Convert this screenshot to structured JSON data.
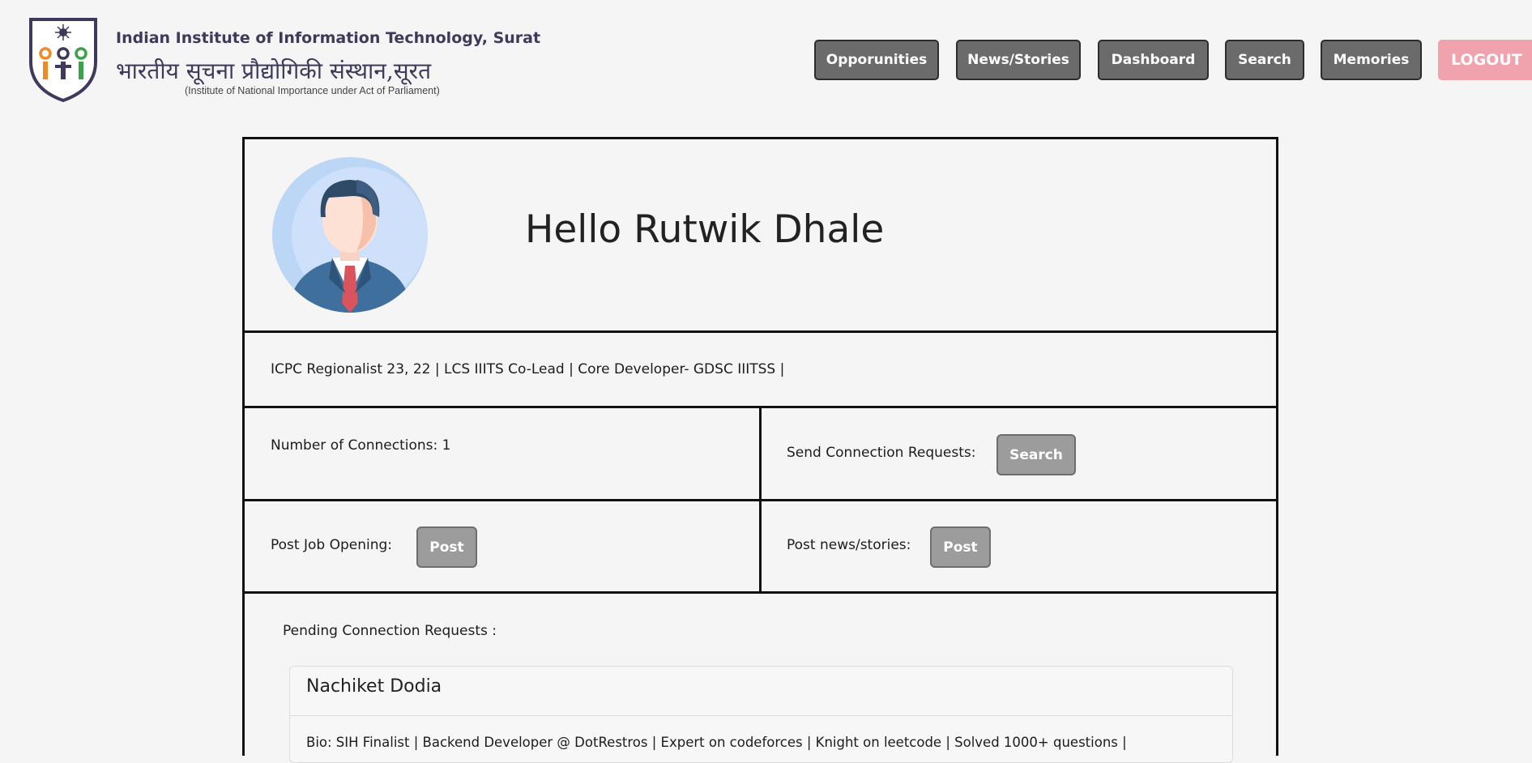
{
  "header": {
    "institute_name_en": "Indian Institute of Information Technology, Surat",
    "institute_name_hi": "भारतीय सूचना प्रौद्योगिकी संस्थान,सूरत",
    "institute_subtitle": "(Institute of National Importance under Act of Parliament)",
    "logo_icon": "iiit-surat-emblem",
    "nav": [
      {
        "label": "Opporunities"
      },
      {
        "label": "News/Stories"
      },
      {
        "label": "Dashboard"
      },
      {
        "label": "Search"
      },
      {
        "label": "Memories"
      }
    ],
    "logout_label": "LOGOUT",
    "colors": {
      "nav_bg": "#6b6b6b",
      "logout_bg": "#f0a3ad",
      "brand_text": "#3d3a5c"
    }
  },
  "profile": {
    "avatar_icon": "user-avatar-icon",
    "greeting": "Hello Rutwik Dhale",
    "bio": "ICPC Regionalist 23, 22 | LCS IIITS Co-Lead | Core Developer- GDSC IIITSS |",
    "connections_label": "Number of Connections: 1",
    "send_requests_label": "Send Connection Requests:",
    "search_button": "Search",
    "post_job_label": "Post Job Opening:",
    "post_job_button": "Post",
    "post_news_label": "Post news/stories:",
    "post_news_button": "Post"
  },
  "pending": {
    "heading": "Pending Connection Requests :",
    "requests": [
      {
        "name": "Nachiket Dodia",
        "bio": "Bio: SIH Finalist | Backend Developer @ DotRestros | Expert on codeforces | Knight on leetcode | Solved 1000+ questions |"
      }
    ]
  }
}
